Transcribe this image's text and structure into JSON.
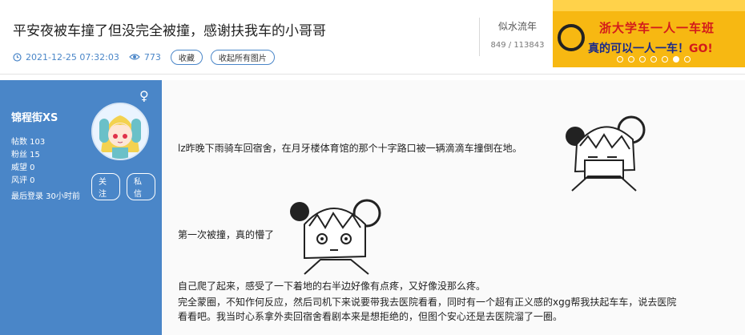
{
  "header": {
    "title": "平安夜被车撞了但没完全被撞，感谢扶我车的小哥哥",
    "datetime": "2021-12-25 07:32:03",
    "views": "773",
    "favorite_label": "收藏",
    "collapse_images_label": "收起所有图片"
  },
  "forum": {
    "name": "似水流年",
    "counts": "849 / 113843"
  },
  "banner": {
    "line1": "浙大学车一人一车班",
    "line2": "真的可以一人一车！",
    "go": "GO!"
  },
  "user": {
    "gender_symbol": "♀",
    "name": "锦程街XS",
    "stats": [
      "帖数 103",
      "粉丝 15",
      "威望 0",
      "风评 0"
    ],
    "last_login": "最后登录 30小时前",
    "follow_label": "关注",
    "message_label": "私信"
  },
  "post": {
    "p1": "lz昨晚下雨骑车回宿舍，在月牙楼体育馆的那个十字路口被一辆滴滴车撞倒在地。",
    "p2": "第一次被撞，真的懵了",
    "p3": "自己爬了起来，感受了一下着地的右半边好像有点疼，又好像没那么疼。",
    "p4": "完全蒙圈，不知作何反应，然后司机下来说要带我去医院看看，同时有一个超有正义感的xgg帮我扶起车车，说去医院",
    "p5": "看看吧。我当时心系拿外卖回宿舍看剧本来是想拒绝的，但图个安心还是去医院溜了一圈。"
  },
  "colors": {
    "accent": "#4a86c8",
    "banner_bg": "#f7b812",
    "banner_red": "#d31b1b",
    "banner_blue": "#1b2a8a"
  },
  "icons": [
    "clock-icon",
    "eye-icon",
    "female-icon"
  ]
}
